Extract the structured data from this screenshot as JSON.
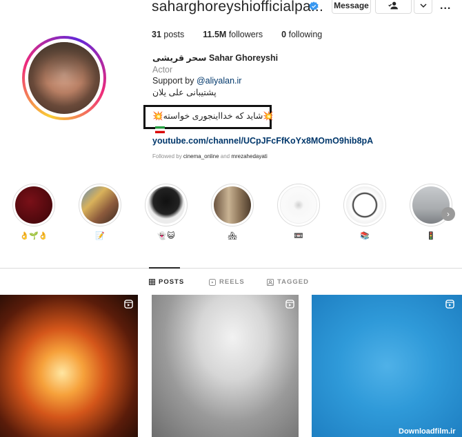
{
  "profile": {
    "username": "saharghoreyshiofficialpa...",
    "actions": {
      "message": "Message",
      "more": "..."
    },
    "stats": [
      {
        "count": "31",
        "label": "posts"
      },
      {
        "count": "11.5M",
        "label": "followers"
      },
      {
        "count": "0",
        "label": "following"
      }
    ],
    "bio": {
      "name": "سحر قریشی Sahar Ghoreyshi",
      "category": "Actor",
      "support_prefix": "Support by ",
      "support_handle": "@aliyalan.ir",
      "support_fa": "پشتیبانی علی یلان",
      "line2": "💥شاید که خدااینجوری خواسته💥",
      "flag": "🇮🇷",
      "link": "youtube.com/channel/UCpJFcFfKoYx8MOmO9hib8pA",
      "followed_prefix": "Followed by ",
      "followed_user1": "cinema_online",
      "followed_and": " and ",
      "followed_user2": "mrezahedayati"
    }
  },
  "highlights": [
    {
      "label": "👌🌱👌",
      "color": "#5a0a10"
    },
    {
      "label": "📝",
      "color": "#9c7a5e"
    },
    {
      "label": "👻😺",
      "color": "#1a1a1a"
    },
    {
      "label": "🏘",
      "color": "#a58a6a"
    },
    {
      "label": "📼",
      "color": "#f4f4f4"
    },
    {
      "label": "📚",
      "color": "#e8e8e8"
    },
    {
      "label": "🚦",
      "color": "#b5b8bb"
    }
  ],
  "tabs": [
    {
      "label": "POSTS",
      "icon": "grid-icon"
    },
    {
      "label": "REELS",
      "icon": "reels-icon"
    },
    {
      "label": "TAGGED",
      "icon": "tagged-icon"
    }
  ],
  "watermark": "Downloadfilm.ir",
  "colors": {
    "link": "#00376b",
    "verified": "#3897f0",
    "muted": "#8e8e8e"
  }
}
